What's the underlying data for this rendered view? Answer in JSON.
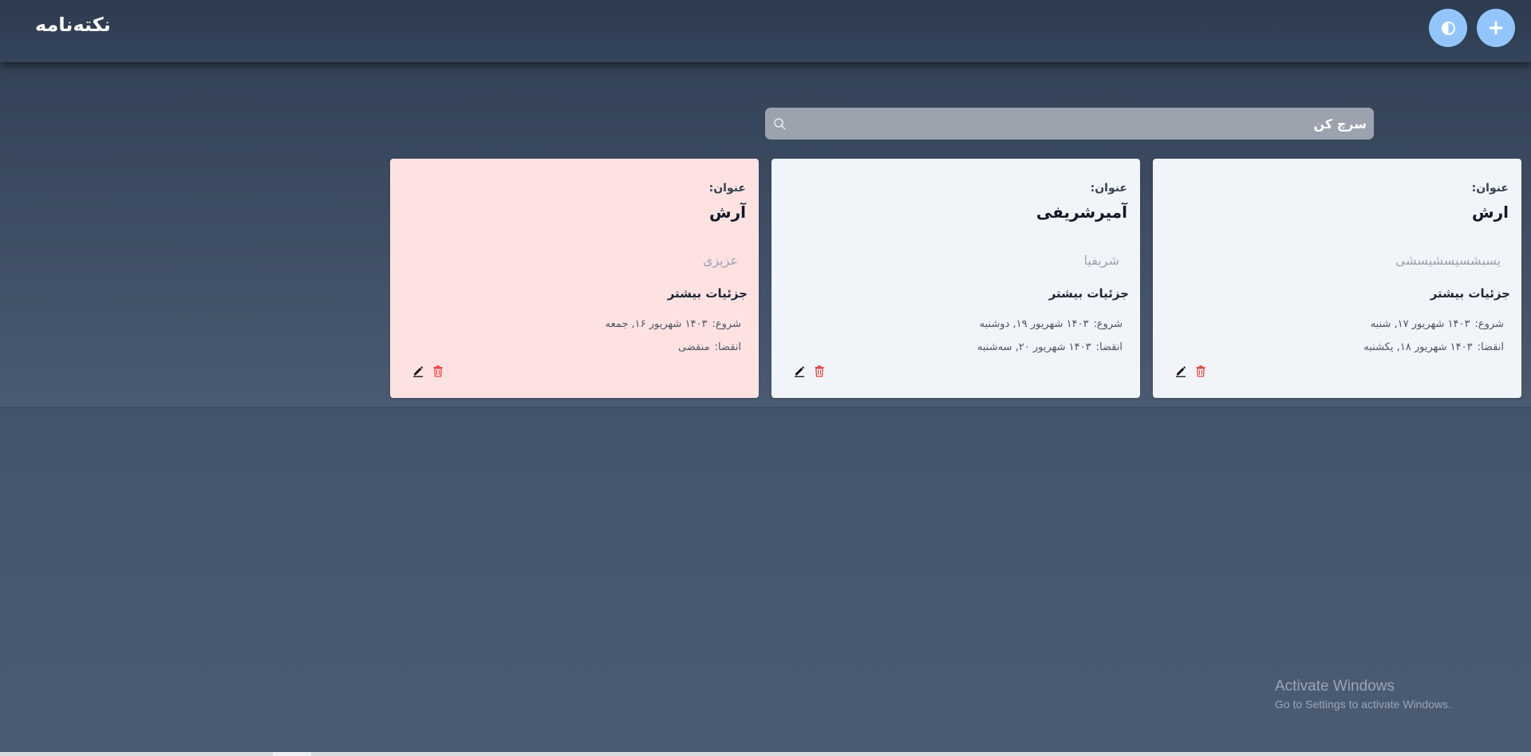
{
  "navbar": {
    "brand": "نکته‌نامه",
    "theme_icon": "half-circle-icon",
    "add_icon": "plus-icon",
    "add_glyph": "+",
    "button_color": "#93c5fd"
  },
  "search": {
    "placeholder": "سرچ کن",
    "value": "",
    "icon": "search-icon"
  },
  "cards": [
    {
      "title_label": "عنوان:",
      "title": "ارش",
      "description": "یسبشسیسشیسشی",
      "more_label": "جزئیات بیشتر",
      "start_label": "شروع:",
      "start_value": "۱۴۰۳ شهریور ۱۷, شنبه",
      "end_label": "انقضا:",
      "end_value": "۱۴۰۳ شهریور ۱۸, یکشنبه",
      "expired": false
    },
    {
      "title_label": "عنوان:",
      "title": "آمیرشریفی",
      "description": "شریفیا",
      "more_label": "جزئیات بیشتر",
      "start_label": "شروع:",
      "start_value": "۱۴۰۳ شهریور ۱۹, دوشنبه",
      "end_label": "انقضا:",
      "end_value": "۱۴۰۳ شهریور ۲۰, سه‌شنبه",
      "expired": false
    },
    {
      "title_label": "عنوان:",
      "title": "آرش",
      "description": "عزیزی",
      "more_label": "جزئیات بیشتر",
      "start_label": "شروع:",
      "start_value": "۱۴۰۳ شهریور ۱۶, جمعه",
      "end_label": "انقضا:",
      "end_value": "منقضی",
      "expired": true
    }
  ],
  "card_colors": {
    "default": "#f1f5f9",
    "expired": "#fee2e2",
    "delete": "#ef4444"
  },
  "watermark": {
    "title": "Activate Windows",
    "subtitle": "Go to Settings to activate Windows."
  }
}
